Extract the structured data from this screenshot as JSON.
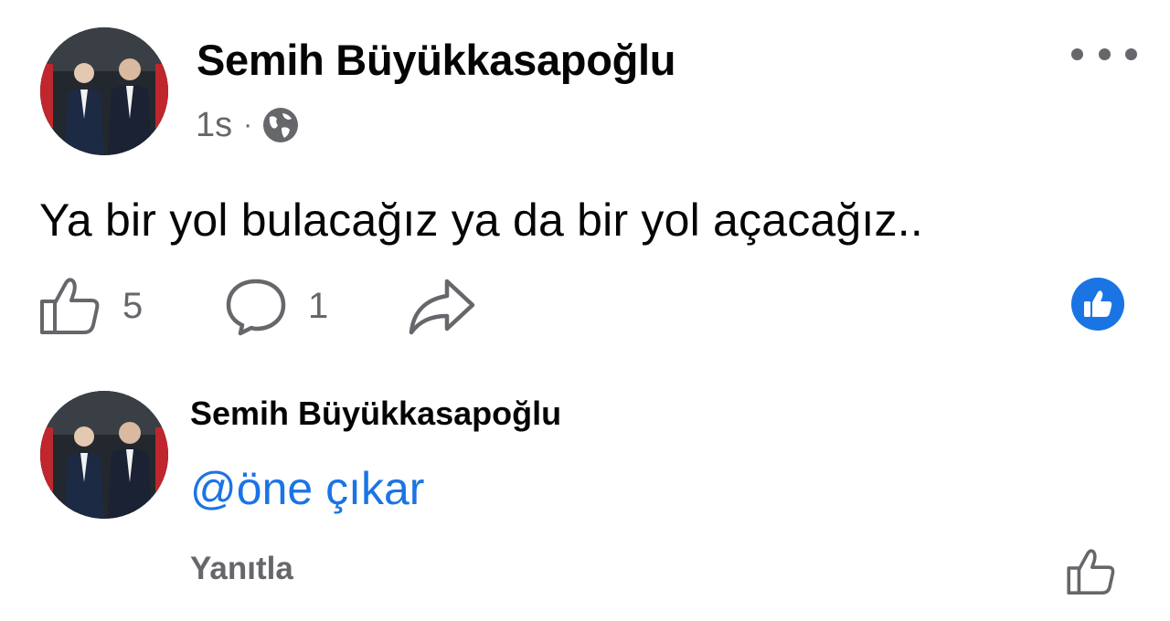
{
  "post": {
    "author": "Semih Büyükkasapoğlu",
    "time": "1s",
    "separator": "·",
    "privacy_icon": "globe-icon",
    "text": "Ya bir yol bulacağız ya da bir yol açacağız..",
    "like_count": "5",
    "comment_count": "1"
  },
  "comment": {
    "author": "Semih Büyükkasapoğlu",
    "text": "@öne çıkar",
    "reply_label": "Yanıtla"
  },
  "colors": {
    "accent": "#1b74e4",
    "secondary_text": "#65676b",
    "primary_text": "#050505"
  }
}
